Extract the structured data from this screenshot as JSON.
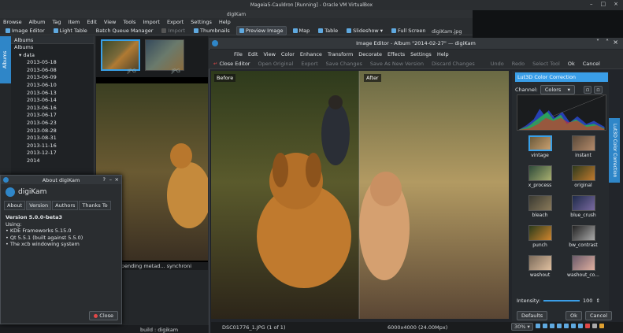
{
  "host_title": "Mageia5-Cauldron [Running] - Oracle VM VirtualBox",
  "host_controls": [
    "–",
    "□",
    "×"
  ],
  "app": {
    "title": "digiKam",
    "menu": [
      "Browse",
      "Album",
      "Tag",
      "Item",
      "Edit",
      "View",
      "Tools",
      "Import",
      "Export",
      "Settings",
      "Help"
    ],
    "toolbar": [
      {
        "label": "Image Editor"
      },
      {
        "label": "Light Table"
      },
      {
        "label": "Batch Queue Manager"
      },
      {
        "label": "Import"
      },
      {
        "label": "Thumbnails"
      },
      {
        "label": "Preview Image"
      },
      {
        "label": "Map"
      },
      {
        "label": "Table"
      },
      {
        "label": "Slideshow"
      },
      {
        "label": "Full Screen"
      }
    ],
    "active_view": "Preview Image",
    "side_tab": "Albums",
    "albums_header": "Albums",
    "albums": [
      "Albums",
      "data",
      "2013-05-18",
      "2013-06-08",
      "2013-06-09",
      "2013-06-10",
      "2013-06-13",
      "2013-06-14",
      "2013-06-16",
      "2013-06-17",
      "2013-06-23",
      "2013-08-28",
      "2013-08-31",
      "2013-11-16",
      "2013-12-17",
      "2014"
    ],
    "thumb_labels": [
      "JPG",
      "JPG"
    ],
    "file_label": "digiKam.jpg",
    "status": "No pending metad... synchroni",
    "build": "build : digikam"
  },
  "about": {
    "title": "About digiKam",
    "name": "digiKam",
    "tabs": [
      "About",
      "Version",
      "Authors",
      "Thanks To"
    ],
    "active_tab": "Version",
    "version": "Version 5.0.0-beta3",
    "using": "Using:",
    "items": [
      "KDE Frameworks 5.15.0",
      "Qt 5.5.1 (built against 5.5.0)",
      "The xcb windowing system"
    ],
    "close": "Close"
  },
  "editor": {
    "title": "Image Editor - Album \"2014-02-27\" — digiKam",
    "menu": [
      "File",
      "Edit",
      "View",
      "Color",
      "Enhance",
      "Transform",
      "Decorate",
      "Effects",
      "Settings",
      "Help"
    ],
    "toolbar": [
      {
        "label": "Close Editor",
        "enabled": true
      },
      {
        "label": "Open Original",
        "enabled": false
      },
      {
        "label": "Export",
        "enabled": false
      },
      {
        "label": "Save Changes",
        "enabled": false
      },
      {
        "label": "Save As New Version",
        "enabled": false
      },
      {
        "label": "Discard Changes",
        "enabled": false
      },
      {
        "label": "Undo",
        "enabled": false
      },
      {
        "label": "Redo",
        "enabled": false
      },
      {
        "label": "Select Tool",
        "enabled": false
      }
    ],
    "ok": "Ok",
    "cancel": "Cancel",
    "before": "Before",
    "after": "After",
    "panel_title": "Lut3D Color Correction",
    "channel_label": "Channel:",
    "channel": "Colors",
    "filters": [
      "vintage",
      "instant",
      "x_process",
      "original",
      "bleach",
      "blue_crush",
      "punch",
      "bw_contrast",
      "washout",
      "washout_co..."
    ],
    "intensity_label": "Intensity:",
    "intensity": 100,
    "defaults": "Defaults",
    "side_tab": "Lut3D Color Correction",
    "status_file": "DSC01776_1.JPG (1 of 1)",
    "status_size": "6000x4000 (24.00Mpx)",
    "zoom": "30%"
  }
}
